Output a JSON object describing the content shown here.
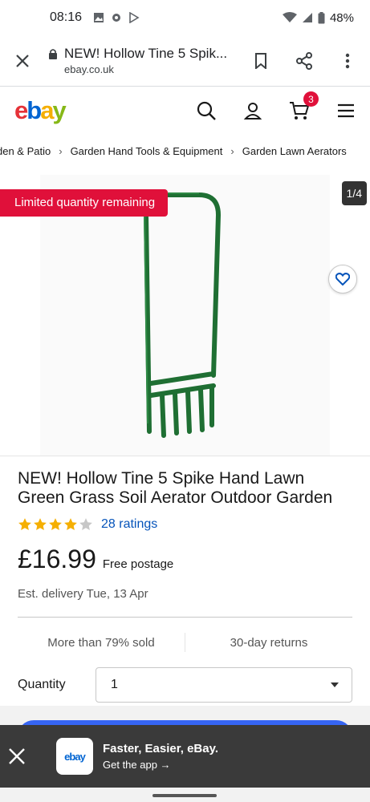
{
  "status_bar": {
    "time": "08:16",
    "battery": "48%"
  },
  "browser": {
    "tab_title": "NEW! Hollow Tine 5 Spik...",
    "domain": "ebay.co.uk"
  },
  "header": {
    "logo": [
      "e",
      "b",
      "a",
      "y"
    ],
    "cart_count": "3"
  },
  "breadcrumb": [
    "den & Patio",
    "Garden Hand Tools & Equipment",
    "Garden Lawn Aerators"
  ],
  "gallery": {
    "promo": "Limited quantity remaining",
    "counter": "1/4"
  },
  "product": {
    "title": "NEW! Hollow Tine 5 Spike Hand Lawn Green Grass Soil Aerator Outdoor Garden",
    "rating": 4,
    "rating_max": 5,
    "ratings_link": "28 ratings",
    "price": "£16.99",
    "shipping": "Free postage",
    "delivery": "Est. delivery Tue, 13 Apr",
    "facts": [
      "More than 79% sold",
      "30-day returns"
    ],
    "quantity_label": "Quantity",
    "quantity_value": "1"
  },
  "app_banner": {
    "icon_text": "ebay",
    "title": "Faster, Easier, eBay.",
    "cta": "Get the app →"
  },
  "colors": {
    "ebay_red": "#e53238",
    "ebay_blue": "#0064d2",
    "ebay_yellow": "#f5af02",
    "ebay_green": "#86b817",
    "promo_red": "#e0103a",
    "link_blue": "#0654ba",
    "buy_blue": "#3665f3"
  }
}
